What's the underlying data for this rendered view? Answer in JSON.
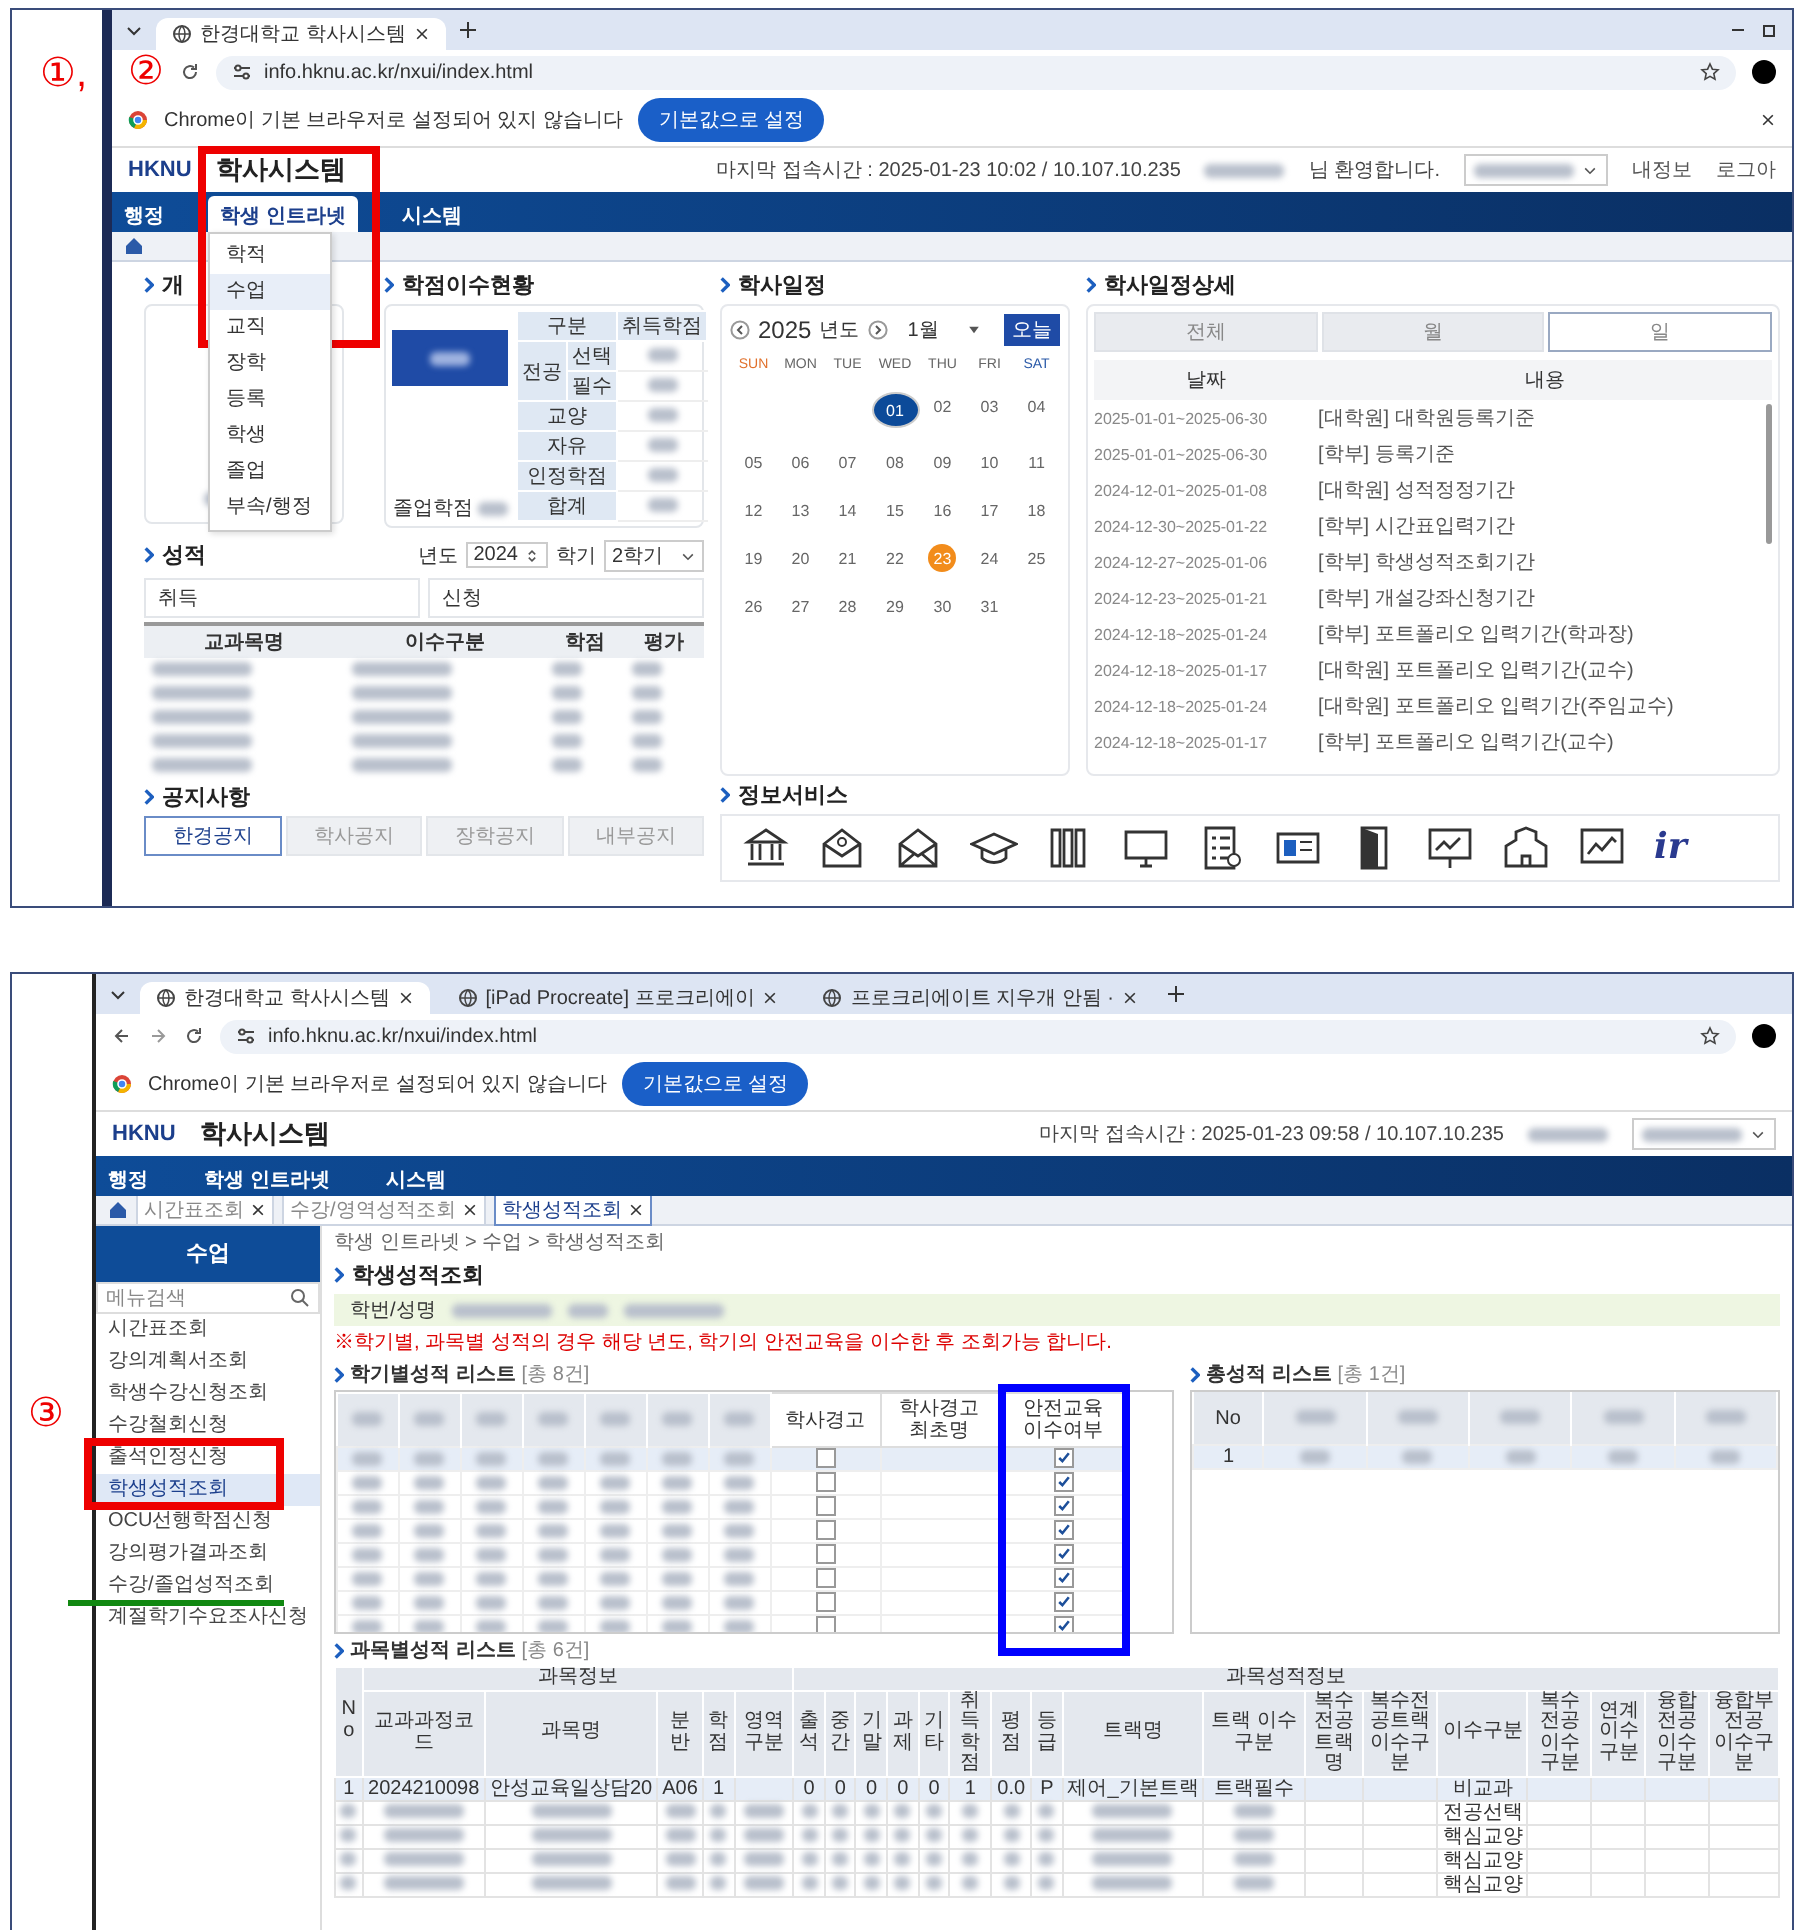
{
  "screenshot_1": {
    "annotation_marks": [
      "①,",
      "②"
    ],
    "browser": {
      "tabs": [
        {
          "title": "한경대학교 학사시스템",
          "selected": true
        }
      ],
      "url": "info.hknu.ac.kr/nxui/index.html"
    },
    "infobar": {
      "text": "Chrome이 기본 브라우저로 설정되어 있지 않습니다",
      "button": "기본값으로 설정"
    },
    "header": {
      "logo": "HKNU",
      "title": "학사시스템",
      "last_login": "마지막 접속시간 : 2025-01-23 10:02 / 10.107.10.235",
      "welcome": "님 환영합니다.",
      "links": [
        "내정보",
        "로그아"
      ]
    },
    "nav": [
      {
        "label": "행정",
        "selected": false
      },
      {
        "label": "학생 인트라넷",
        "selected": true
      },
      {
        "label": "시스템",
        "selected": false
      }
    ],
    "menu": [
      {
        "label": "학적",
        "selected": false
      },
      {
        "label": "수업",
        "selected": true
      },
      {
        "label": "교직",
        "selected": false
      },
      {
        "label": "장학",
        "selected": false
      },
      {
        "label": "등록",
        "selected": false
      },
      {
        "label": "학생",
        "selected": false
      },
      {
        "label": "졸업",
        "selected": false
      },
      {
        "label": "부속/행정",
        "selected": false
      }
    ],
    "profile": {
      "title": "개"
    },
    "credits": {
      "title": "학점이수현황",
      "columns": [
        "구분",
        "취득학점"
      ],
      "major": "전공",
      "major_rows": [
        "선택",
        "필수"
      ],
      "rows": [
        "교양",
        "자유",
        "인정학점",
        "합계"
      ],
      "graduation_label": "졸업학점"
    },
    "grades": {
      "title": "성적",
      "year_label": "년도",
      "year": "2024",
      "term_label": "학기",
      "term": "2학기",
      "summary": [
        "취득",
        "신청"
      ],
      "columns": [
        "교과목명",
        "이수구분",
        "학점",
        "평가"
      ]
    },
    "calendar": {
      "title": "학사일정",
      "year": "2025",
      "year_label": "년도",
      "month": "1월",
      "today_button": "오늘",
      "weekdays": [
        "SUN",
        "MON",
        "TUE",
        "WED",
        "THU",
        "FRI",
        "SAT"
      ],
      "weeks": [
        [
          {
            "label": "01",
            "selected": true,
            "today": false
          },
          {
            "label": "02",
            "selected": false,
            "today": false
          },
          {
            "label": "03",
            "selected": false,
            "today": false
          },
          {
            "label": "04",
            "selected": false,
            "today": false
          }
        ],
        [
          {
            "label": "05",
            "selected": false,
            "today": false
          },
          {
            "label": "06",
            "selected": false,
            "today": false
          },
          {
            "label": "07",
            "selected": false,
            "today": false
          },
          {
            "label": "08",
            "selected": false,
            "today": false
          },
          {
            "label": "09",
            "selected": false,
            "today": false
          },
          {
            "label": "10",
            "selected": false,
            "today": false
          },
          {
            "label": "11",
            "selected": false,
            "today": false
          }
        ],
        [
          {
            "label": "12",
            "selected": false,
            "today": false
          },
          {
            "label": "13",
            "selected": false,
            "today": false
          },
          {
            "label": "14",
            "selected": false,
            "today": false
          },
          {
            "label": "15",
            "selected": false,
            "today": false
          },
          {
            "label": "16",
            "selected": false,
            "today": false
          },
          {
            "label": "17",
            "selected": false,
            "today": false
          },
          {
            "label": "18",
            "selected": false,
            "today": false
          }
        ],
        [
          {
            "label": "19",
            "selected": false,
            "today": false
          },
          {
            "label": "20",
            "selected": false,
            "today": false
          },
          {
            "label": "21",
            "selected": false,
            "today": false
          },
          {
            "label": "22",
            "selected": false,
            "today": false
          },
          {
            "label": "23",
            "selected": false,
            "today": true
          },
          {
            "label": "24",
            "selected": false,
            "today": false
          },
          {
            "label": "25",
            "selected": false,
            "today": false
          }
        ],
        [
          {
            "label": "26",
            "selected": false,
            "today": false
          },
          {
            "label": "27",
            "selected": false,
            "today": false
          },
          {
            "label": "28",
            "selected": false,
            "today": false
          },
          {
            "label": "29",
            "selected": false,
            "today": false
          },
          {
            "label": "30",
            "selected": false,
            "today": false
          },
          {
            "label": "31",
            "selected": false,
            "today": false
          }
        ]
      ]
    },
    "schedule": {
      "title": "학사일정상세",
      "tabs": [
        {
          "label": "전체",
          "selected": false
        },
        {
          "label": "월",
          "selected": false
        },
        {
          "label": "일",
          "selected": true
        }
      ],
      "columns": [
        "날짜",
        "내용"
      ],
      "rows": [
        {
          "date": "2025-01-01~2025-06-30",
          "content": "[대학원] 대학원등록기준"
        },
        {
          "date": "2025-01-01~2025-06-30",
          "content": "[학부] 등록기준"
        },
        {
          "date": "2024-12-01~2025-01-08",
          "content": "[대학원] 성적정정기간"
        },
        {
          "date": "2024-12-30~2025-01-22",
          "content": "[학부] 시간표입력기간"
        },
        {
          "date": "2024-12-27~2025-01-06",
          "content": "[학부] 학생성적조회기간"
        },
        {
          "date": "2024-12-23~2025-01-21",
          "content": "[학부] 개설강좌신청기간"
        },
        {
          "date": "2024-12-18~2025-01-24",
          "content": "[학부] 포트폴리오 입력기간(학과장)"
        },
        {
          "date": "2024-12-18~2025-01-17",
          "content": "[대학원] 포트폴리오 입력기간(교수)"
        },
        {
          "date": "2024-12-18~2025-01-24",
          "content": "[대학원] 포트폴리오 입력기간(주임교수)"
        },
        {
          "date": "2024-12-18~2025-01-17",
          "content": "[학부] 포트폴리오 입력기간(교수)"
        }
      ]
    },
    "notices": {
      "title": "공지사항",
      "tabs": [
        {
          "label": "한경공지",
          "selected": true
        },
        {
          "label": "학사공지",
          "selected": false
        },
        {
          "label": "장학공지",
          "selected": false
        },
        {
          "label": "내부공지",
          "selected": false
        }
      ]
    },
    "services": {
      "title": "정보서비스",
      "ir_logo": "ir"
    }
  },
  "screenshot_2": {
    "annotation_marks": [
      "③"
    ],
    "browser": {
      "tabs": [
        {
          "title": "한경대학교 학사시스템",
          "selected": true
        },
        {
          "title": "[iPad Procreate] 프로크리에이",
          "selected": false
        },
        {
          "title": "프로크리에이트 지우개 안됨 ·",
          "selected": false
        }
      ],
      "url": "info.hknu.ac.kr/nxui/index.html"
    },
    "infobar": {
      "text": "Chrome이 기본 브라우저로 설정되어 있지 않습니다",
      "button": "기본값으로 설정"
    },
    "header": {
      "logo": "HKNU",
      "title": "학사시스템",
      "last_login": "마지막 접속시간 : 2025-01-23 09:58 / 10.107.10.235"
    },
    "nav": [
      {
        "label": "행정",
        "selected": false
      },
      {
        "label": "학생 인트라넷",
        "selected": false
      },
      {
        "label": "시스템",
        "selected": false
      }
    ],
    "page_tabs": [
      {
        "label": "시간표조회",
        "selected": false
      },
      {
        "label": "수강/영역성적조회",
        "selected": false
      },
      {
        "label": "학생성적조회",
        "selected": true
      }
    ],
    "sidebar": {
      "title": "수업",
      "search_placeholder": "메뉴검색",
      "items": [
        {
          "label": "시간표조회",
          "selected": false
        },
        {
          "label": "강의계획서조회",
          "selected": false
        },
        {
          "label": "학생수강신청조회",
          "selected": false
        },
        {
          "label": "수강철회신청",
          "selected": false
        },
        {
          "label": "출석인정신청",
          "selected": false
        },
        {
          "label": "학생성적조회",
          "selected": true
        },
        {
          "label": "OCU선행학점신청",
          "selected": false
        },
        {
          "label": "강의평가결과조회",
          "selected": false
        },
        {
          "label": "수강/졸업성적조회",
          "selected": false
        },
        {
          "label": "계절학기수요조사신청",
          "selected": false
        }
      ]
    },
    "breadcrumb": "학생 인트라넷 > 수업 > 학생성적조회",
    "page_title": "학생성적조회",
    "student_label": "학번/성명",
    "warning": "※학기별, 과목별 성적의 경우 해당 년도, 학기의 안전교육을 이수한 후 조회가능 합니다.",
    "term_list": {
      "title": "학기별성적 리스트",
      "count": "[총 8건]",
      "columns": [
        "학사경고",
        "학사경고 최초명",
        "안전교육 이수여부"
      ],
      "rows": [
        {
          "warning": false,
          "safety_done": true
        },
        {
          "warning": false,
          "safety_done": true
        },
        {
          "warning": false,
          "safety_done": true
        },
        {
          "warning": false,
          "safety_done": true
        },
        {
          "warning": false,
          "safety_done": true
        },
        {
          "warning": false,
          "safety_done": true
        },
        {
          "warning": false,
          "safety_done": true
        },
        {
          "warning": false,
          "safety_done": true
        }
      ]
    },
    "total_list": {
      "title": "총성적 리스트",
      "count": "[총 1건]",
      "columns": [
        "No"
      ],
      "rows": [
        "1"
      ]
    },
    "course_list": {
      "title": "과목별성적 리스트",
      "count": "[총 6건]",
      "no_column": "No",
      "groups": [
        {
          "label": "과목정보",
          "columns": [
            "교과과정코드",
            "과목명",
            "분반",
            "학점",
            "영역구분"
          ]
        },
        {
          "label": "과목성적정보",
          "columns": [
            "출석",
            "중간",
            "기말",
            "과제",
            "기타",
            "취득학점",
            "평점",
            "등급",
            "트랙명",
            "트랙 이수구분",
            "복수전공 트랙명",
            "복수전공트랙 이수구분",
            "이수구분",
            "복수전공 이수구분",
            "연계 이수구분",
            "융합전공 이수구분",
            "융합부전공 이수구분"
          ]
        }
      ],
      "rows": [
        {
          "blurred": false,
          "cells": [
            "1",
            "2024210098",
            "안성교육일상담20",
            "A06",
            "1",
            null,
            "0",
            "0",
            "0",
            "0",
            "0",
            "1",
            "0.0",
            "P",
            "제어_기본트랙",
            "트랙필수",
            null,
            null,
            "비교과",
            null,
            null,
            null,
            null
          ]
        },
        {
          "blurred": true,
          "category": "전공선택"
        },
        {
          "blurred": true,
          "category": "핵심교양"
        },
        {
          "blurred": true,
          "category": "핵심교양"
        },
        {
          "blurred": true,
          "category": "핵심교양"
        }
      ]
    }
  }
}
